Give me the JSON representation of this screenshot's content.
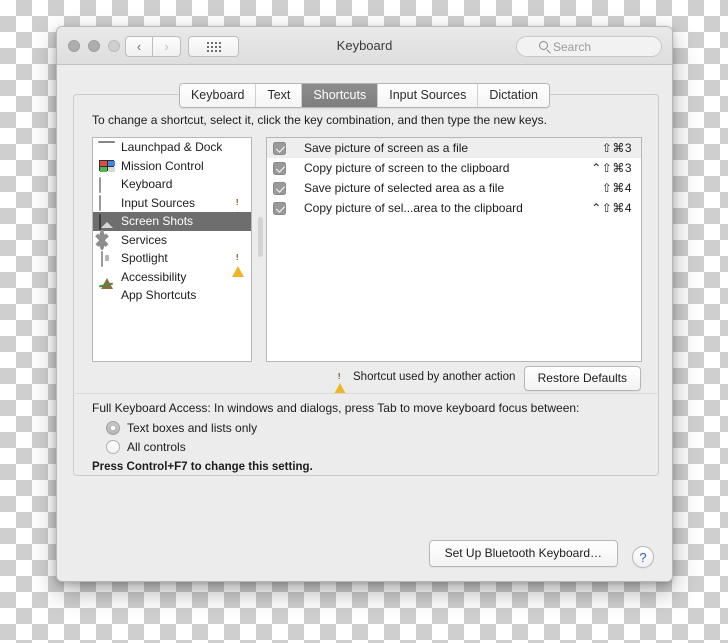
{
  "window": {
    "title": "Keyboard",
    "traffic_lights": [
      "close",
      "minimize",
      "zoom"
    ],
    "nav_back_icon": "chevron-left-icon",
    "nav_forward_icon": "chevron-right-icon",
    "grid_icon": "show-all-icon",
    "search": {
      "placeholder": "Search",
      "icon": "search-icon"
    }
  },
  "tabs": [
    {
      "label": "Keyboard",
      "active": false
    },
    {
      "label": "Text",
      "active": false
    },
    {
      "label": "Shortcuts",
      "active": true
    },
    {
      "label": "Input Sources",
      "active": false
    },
    {
      "label": "Dictation",
      "active": false
    }
  ],
  "instructions": "To change a shortcut, select it, click the key combination, and then type the new keys.",
  "sidebar": {
    "items": [
      {
        "label": "Launchpad & Dock",
        "icon": "laptop-icon",
        "selected": false,
        "warning": false
      },
      {
        "label": "Mission Control",
        "icon": "mission-control-icon",
        "selected": false,
        "warning": false
      },
      {
        "label": "Keyboard",
        "icon": "window-icon",
        "selected": false,
        "warning": false
      },
      {
        "label": "Input Sources",
        "icon": "window-icon",
        "selected": false,
        "warning": true
      },
      {
        "label": "Screen Shots",
        "icon": "screenshot-icon",
        "selected": true,
        "warning": false
      },
      {
        "label": "Services",
        "icon": "gear-icon",
        "selected": false,
        "warning": false
      },
      {
        "label": "Spotlight",
        "icon": "document-icon",
        "selected": false,
        "warning": true
      },
      {
        "label": "Accessibility",
        "icon": "accessibility-icon",
        "selected": false,
        "warning": false
      },
      {
        "label": "App Shortcuts",
        "icon": "app-shortcuts-icon",
        "selected": false,
        "warning": false
      }
    ]
  },
  "shortcuts": {
    "rows": [
      {
        "checked": true,
        "name": "Save picture of screen as a file",
        "keys": "⇧⌘3"
      },
      {
        "checked": true,
        "name": "Copy picture of screen to the clipboard",
        "keys": "⌃⇧⌘3"
      },
      {
        "checked": true,
        "name": "Save picture of selected area as a file",
        "keys": "⇧⌘4"
      },
      {
        "checked": true,
        "name": "Copy picture of sel...area to the clipboard",
        "keys": "⌃⇧⌘4"
      }
    ]
  },
  "legend": {
    "icon": "warning-triangle-icon",
    "text": "Shortcut used by another action"
  },
  "restore_defaults_label": "Restore Defaults",
  "full_keyboard_access": {
    "title": "Full Keyboard Access: In windows and dialogs, press Tab to move keyboard focus between:",
    "options": [
      {
        "label": "Text boxes and lists only",
        "selected": true
      },
      {
        "label": "All controls",
        "selected": false
      }
    ],
    "hint": "Press Control+F7 to change this setting."
  },
  "footer": {
    "bluetooth_label": "Set Up Bluetooth Keyboard…",
    "help_label": "?"
  },
  "colors": {
    "window_bg": "#ececec",
    "selection": "#6e6e6e",
    "warning": "#f0b429",
    "accent_blue": "#1a86e8",
    "help_blue": "#2a62b5"
  }
}
